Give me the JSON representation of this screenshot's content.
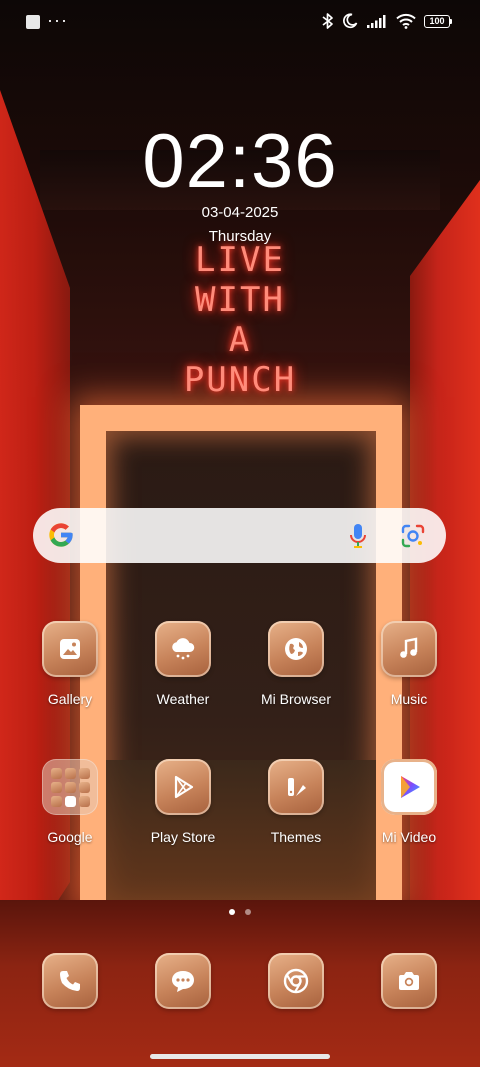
{
  "status_bar": {
    "battery": "100",
    "icons": [
      "notification-square-icon",
      "more-dots-icon",
      "bluetooth-icon",
      "moon-icon",
      "signal-icon",
      "wifi-icon",
      "battery-icon"
    ]
  },
  "wallpaper": {
    "neon_text": "LIVE\nWITH\nA\nPUNCH"
  },
  "clock_widget": {
    "time": "02:36",
    "date": "03-04-2025",
    "day": "Thursday"
  },
  "search_bar": {
    "icons": [
      "google-g-icon",
      "mic-icon",
      "google-lens-icon"
    ]
  },
  "apps": [
    {
      "label": "Gallery",
      "icon": "gallery-icon"
    },
    {
      "label": "Weather",
      "icon": "weather-icon"
    },
    {
      "label": "Mi Browser",
      "icon": "browser-icon"
    },
    {
      "label": "Music",
      "icon": "music-icon"
    },
    {
      "label": "Google",
      "icon": "folder-icon"
    },
    {
      "label": "Play Store",
      "icon": "play-store-icon"
    },
    {
      "label": "Themes",
      "icon": "themes-icon"
    },
    {
      "label": "Mi Video",
      "icon": "mi-video-icon"
    }
  ],
  "page_indicator": {
    "pages": 2,
    "current": 1
  },
  "dock": [
    {
      "name": "Phone",
      "icon": "phone-icon"
    },
    {
      "name": "Messages",
      "icon": "messages-icon"
    },
    {
      "name": "Chrome",
      "icon": "chrome-icon"
    },
    {
      "name": "Camera",
      "icon": "camera-icon"
    }
  ],
  "colors": {
    "icon_tint": "#c7835a",
    "search_bg": "#ffffff",
    "google_blue": "#4285F4",
    "google_red": "#EA4335",
    "google_yellow": "#FBBC05",
    "google_green": "#34A853"
  }
}
